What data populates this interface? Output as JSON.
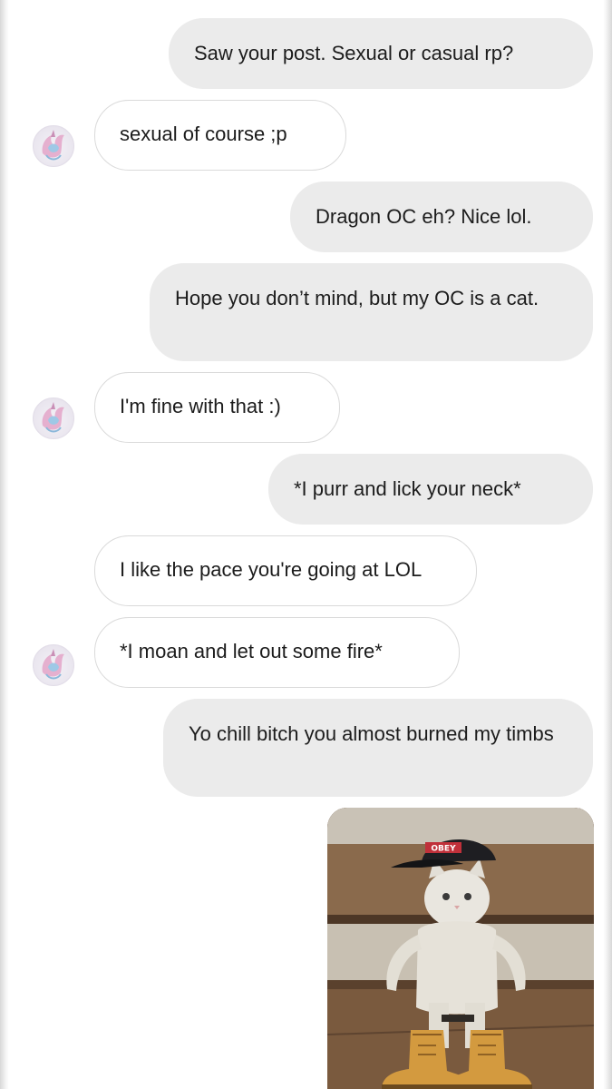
{
  "conversation": {
    "messages": [
      {
        "direction": "outgoing",
        "text": "Saw your post. Sexual or casual rp?"
      },
      {
        "direction": "incoming",
        "text": "sexual of course ;p"
      },
      {
        "direction": "outgoing",
        "text": "Dragon OC eh? Nice lol."
      },
      {
        "direction": "outgoing",
        "text": "Hope you don’t mind, but my OC is a cat."
      },
      {
        "direction": "incoming",
        "text": "I'm fine with that :)"
      },
      {
        "direction": "outgoing",
        "text": "*I purr and lick your neck*"
      },
      {
        "direction": "incoming",
        "text": "I like the pace you're going at LOL"
      },
      {
        "direction": "incoming",
        "text": "*I moan and let out some fire*"
      },
      {
        "direction": "outgoing",
        "text": "Yo chill bitch you almost burned my timbs"
      }
    ],
    "photo": {
      "description": "cat-wearing-cap-and-boots",
      "cap_text": "OBEY"
    },
    "avatar_icon": "dragon-avatar-icon"
  }
}
